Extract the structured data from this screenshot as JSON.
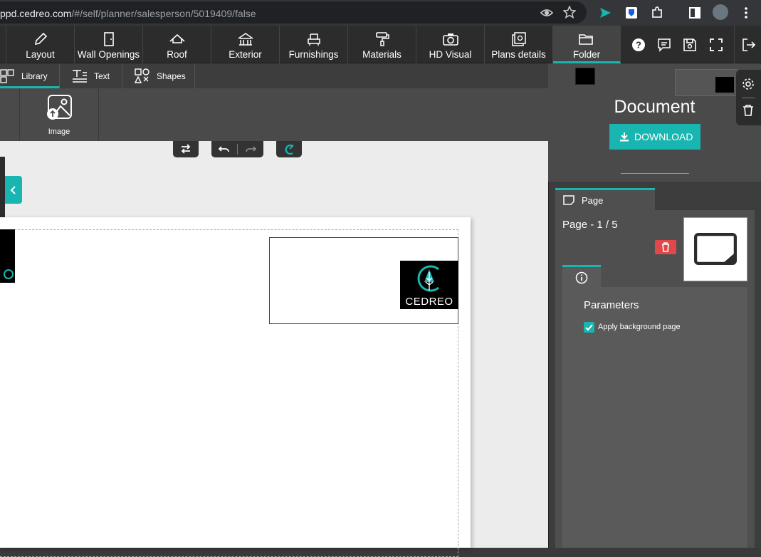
{
  "browser": {
    "url_host": "ppd.cedreo.com",
    "url_path": "/#/self/planner/salesperson/5019409/false"
  },
  "toolbar": {
    "items": [
      {
        "label": "Layout",
        "icon": "pencil-icon"
      },
      {
        "label": "Wall Openings",
        "icon": "door-icon"
      },
      {
        "label": "Roof",
        "icon": "roof-icon"
      },
      {
        "label": "Exterior",
        "icon": "house-exterior-icon"
      },
      {
        "label": "Furnishings",
        "icon": "armchair-icon"
      },
      {
        "label": "Materials",
        "icon": "paint-roller-icon"
      },
      {
        "label": "HD Visual",
        "icon": "camera-icon"
      },
      {
        "label": "Plans details",
        "icon": "plans-icon"
      },
      {
        "label": "Folder",
        "icon": "folder-icon"
      }
    ],
    "active": "Folder"
  },
  "subtabs": {
    "library": "Library",
    "text": "Text",
    "shapes": "Shapes"
  },
  "library": {
    "image_label": "Image"
  },
  "page_canvas": {
    "logo_text": "CEDREO"
  },
  "right_panel": {
    "document_title": "Document",
    "download_label": "DOWNLOAD",
    "page_tab_label": "Page",
    "page_indicator": "Page - 1 / 5",
    "parameters_title": "Parameters",
    "apply_background_label": "Apply background page",
    "apply_background_checked": true
  },
  "colors": {
    "accent": "#19b5b0",
    "danger": "#e0484a"
  }
}
